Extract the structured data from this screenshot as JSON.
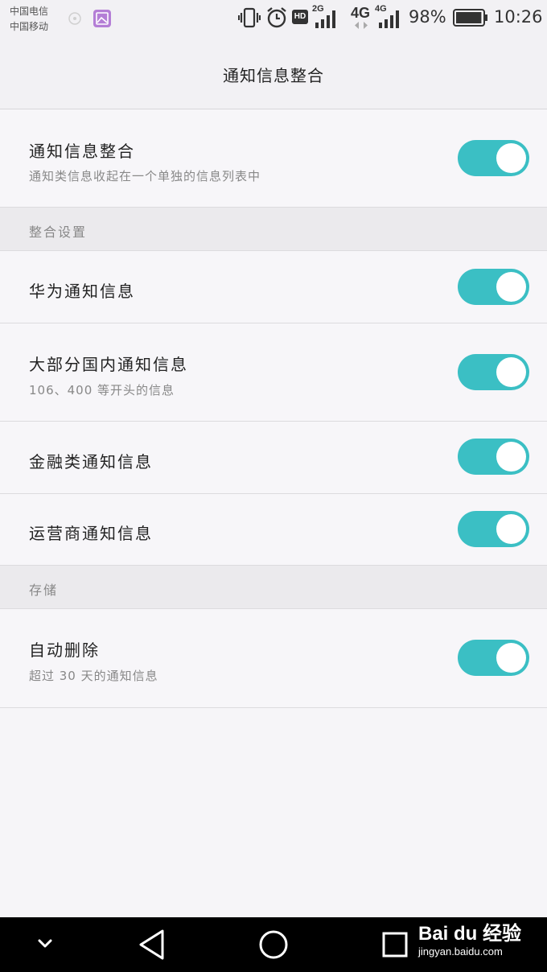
{
  "status_bar": {
    "carrier_1": "中国电信",
    "carrier_2": "中国移动",
    "hd_label": "HD",
    "net_2g": "2G",
    "net_4g_big": "4G",
    "net_4g_small": "4G",
    "battery": "98%",
    "battery_level": 0.98,
    "time": "10:26"
  },
  "header": {
    "title": "通知信息整合"
  },
  "master": {
    "title": "通知信息整合",
    "subtitle": "通知类信息收起在一个单独的信息列表中",
    "enabled": true
  },
  "sections": {
    "merge_settings": "整合设置",
    "storage": "存储"
  },
  "merge_items": [
    {
      "title": "华为通知信息",
      "subtitle": "",
      "enabled": true
    },
    {
      "title": "大部分国内通知信息",
      "subtitle": "106、400 等开头的信息",
      "enabled": true
    },
    {
      "title": "金融类通知信息",
      "subtitle": "",
      "enabled": true
    },
    {
      "title": "运营商通知信息",
      "subtitle": "",
      "enabled": true
    }
  ],
  "storage_item": {
    "title": "自动删除",
    "subtitle": "超过 30 天的通知信息",
    "enabled": true
  },
  "nav_bar": {
    "buttons": [
      "chevron-down-icon",
      "back-triangle-icon",
      "home-circle-icon",
      "recents-square-icon"
    ]
  },
  "watermark": {
    "logo": "Bai du 经验",
    "url": "jingyan.baidu.com"
  },
  "colors": {
    "toggle_on": "#3bbfc4",
    "background": "#f6f5f8",
    "section_bg": "#ebeaed",
    "nav_bar": "#000000"
  }
}
